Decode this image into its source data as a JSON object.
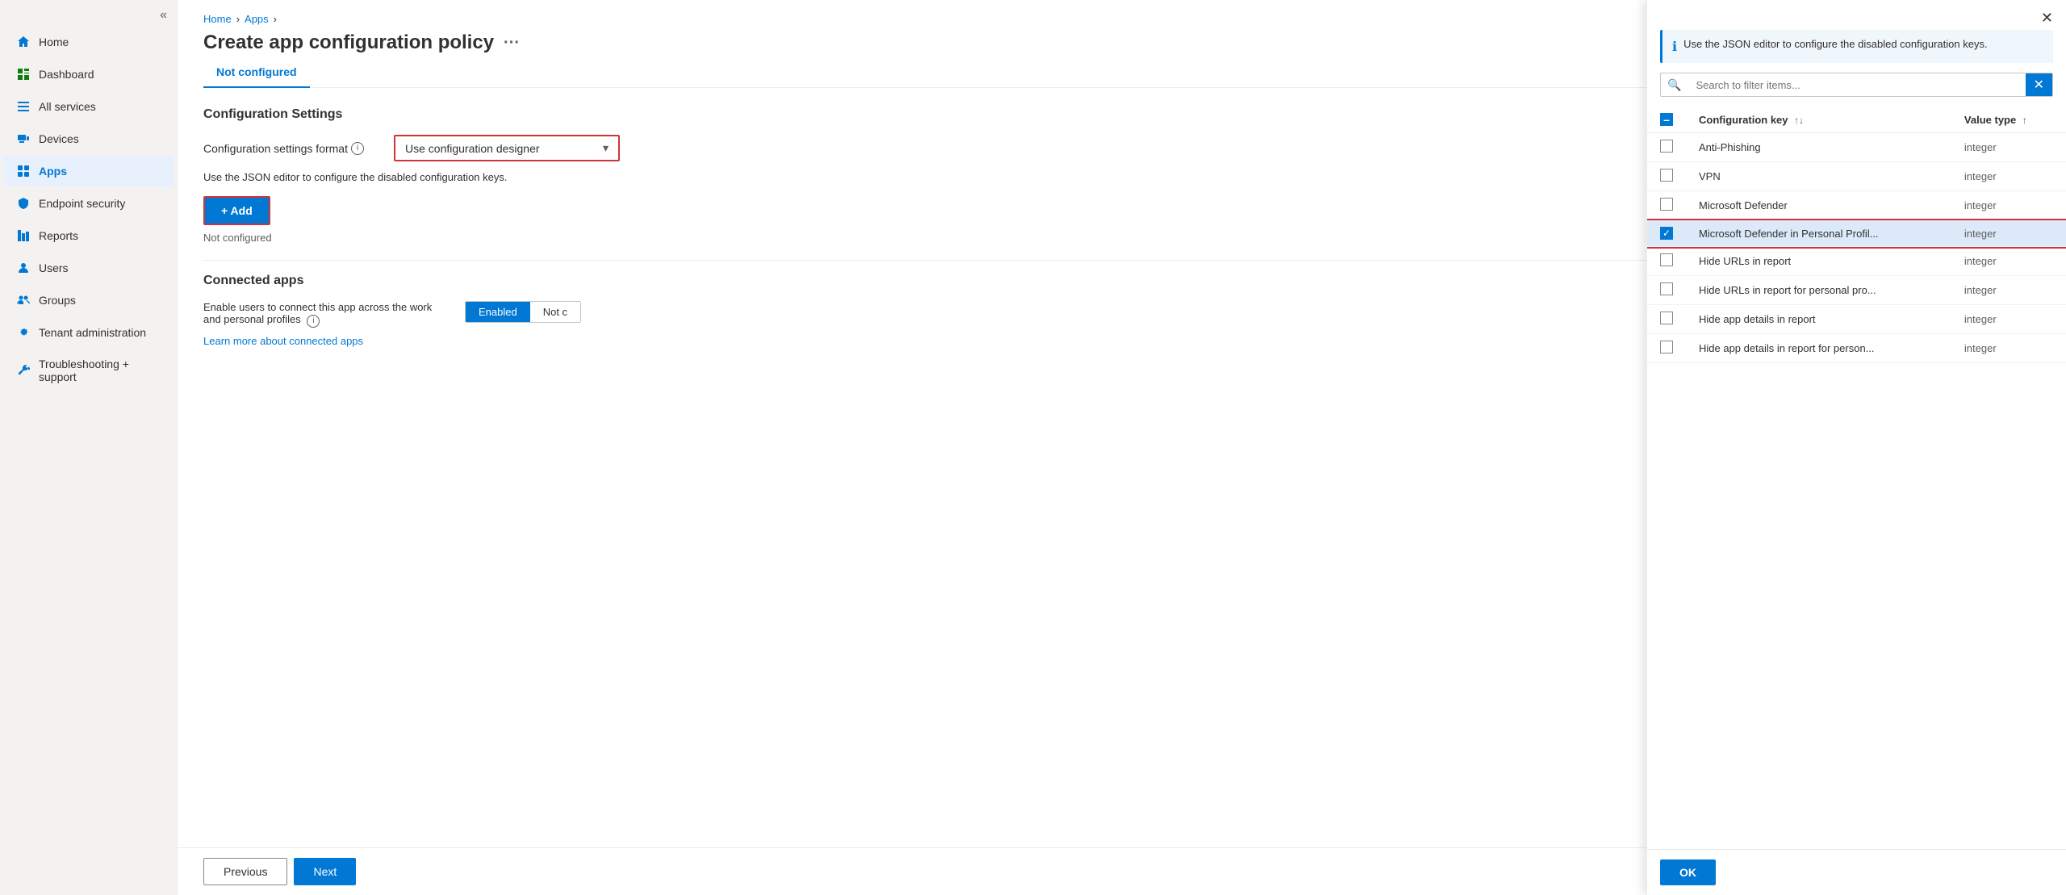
{
  "sidebar": {
    "collapse_icon": "«",
    "items": [
      {
        "id": "home",
        "label": "Home",
        "icon": "home",
        "active": false
      },
      {
        "id": "dashboard",
        "label": "Dashboard",
        "icon": "dashboard",
        "active": false
      },
      {
        "id": "all-services",
        "label": "All services",
        "icon": "grid",
        "active": false
      },
      {
        "id": "devices",
        "label": "Devices",
        "icon": "device",
        "active": false
      },
      {
        "id": "apps",
        "label": "Apps",
        "icon": "apps",
        "active": true
      },
      {
        "id": "endpoint-security",
        "label": "Endpoint security",
        "icon": "shield",
        "active": false
      },
      {
        "id": "reports",
        "label": "Reports",
        "icon": "reports",
        "active": false
      },
      {
        "id": "users",
        "label": "Users",
        "icon": "users",
        "active": false
      },
      {
        "id": "groups",
        "label": "Groups",
        "icon": "groups",
        "active": false
      },
      {
        "id": "tenant-admin",
        "label": "Tenant administration",
        "icon": "settings",
        "active": false
      },
      {
        "id": "troubleshooting",
        "label": "Troubleshooting + support",
        "icon": "wrench",
        "active": false
      }
    ]
  },
  "breadcrumb": {
    "items": [
      "Home",
      "Apps"
    ],
    "separators": [
      "›",
      "›"
    ]
  },
  "page": {
    "title": "Create app configuration policy",
    "ellipsis": "···",
    "tab_label": "Not configured"
  },
  "configuration_settings": {
    "section_label": "Configuration Settings",
    "format_label": "Configuration settings format",
    "format_value": "Use configuration designer",
    "json_info_text": "Use the JSON editor to configure the disabled configuration keys.",
    "add_button_label": "+ Add",
    "not_configured": "Not configured"
  },
  "connected_apps": {
    "section_label": "Connected apps",
    "description": "Enable users to connect this app across the work and personal profiles",
    "toggle_enabled": "Enabled",
    "toggle_not_configured": "Not c",
    "learn_more_label": "Learn more about connected apps"
  },
  "bottom_bar": {
    "previous_label": "Previous",
    "next_label": "Next"
  },
  "panel": {
    "close_icon": "✕",
    "info_text": "Use the JSON editor to configure the disabled configuration keys.",
    "search_placeholder": "Search to filter items...",
    "search_clear_icon": "✕",
    "table": {
      "col_config_key": "Configuration key",
      "col_value_type": "Value type",
      "sort_icon": "↑↓",
      "up_icon": "↑",
      "rows": [
        {
          "id": "anti-phishing",
          "label": "Anti-Phishing",
          "value_type": "integer",
          "checked": false,
          "highlighted": false
        },
        {
          "id": "vpn",
          "label": "VPN",
          "value_type": "integer",
          "checked": false,
          "highlighted": false
        },
        {
          "id": "microsoft-defender",
          "label": "Microsoft Defender",
          "value_type": "integer",
          "checked": false,
          "highlighted": false
        },
        {
          "id": "ms-defender-personal",
          "label": "Microsoft Defender in Personal Profil...",
          "value_type": "integer",
          "checked": true,
          "highlighted": true
        },
        {
          "id": "hide-urls",
          "label": "Hide URLs in report",
          "value_type": "integer",
          "checked": false,
          "highlighted": false
        },
        {
          "id": "hide-urls-personal",
          "label": "Hide URLs in report for personal pro...",
          "value_type": "integer",
          "checked": false,
          "highlighted": false
        },
        {
          "id": "hide-app-details",
          "label": "Hide app details in report",
          "value_type": "integer",
          "checked": false,
          "highlighted": false
        },
        {
          "id": "hide-app-details-personal",
          "label": "Hide app details in report for person...",
          "value_type": "integer",
          "checked": false,
          "highlighted": false
        }
      ]
    },
    "ok_label": "OK"
  }
}
